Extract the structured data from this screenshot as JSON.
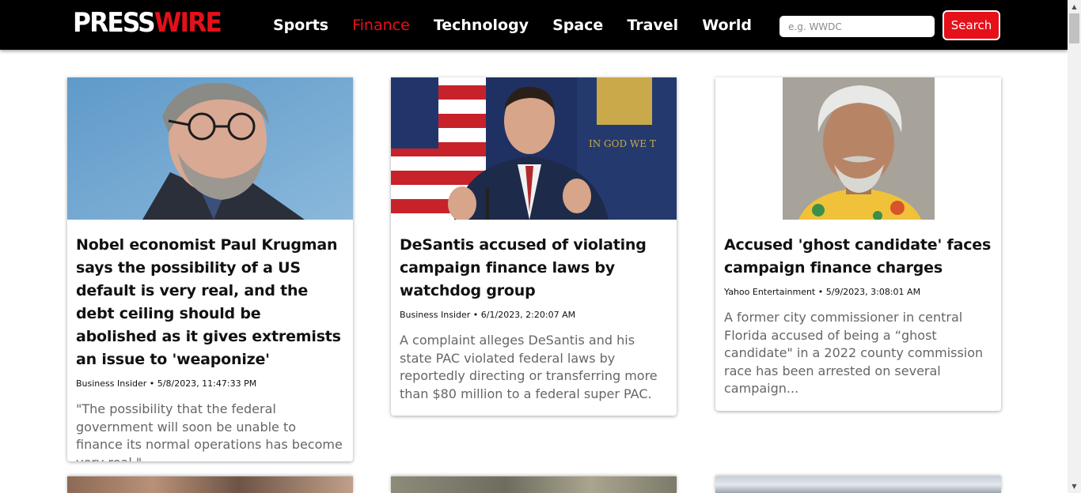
{
  "header": {
    "logo": {
      "part1": "PRESS",
      "part2": "WIRE"
    },
    "nav": [
      {
        "label": "Sports",
        "active": false
      },
      {
        "label": "Finance",
        "active": true
      },
      {
        "label": "Technology",
        "active": false
      },
      {
        "label": "Space",
        "active": false
      },
      {
        "label": "Travel",
        "active": false
      },
      {
        "label": "World",
        "active": false
      }
    ],
    "search": {
      "placeholder": "e.g. WWDC",
      "value": "",
      "button_label": "Search"
    }
  },
  "articles": [
    {
      "title": "Nobel economist Paul Krugman says the possibility of a US default is very real, and the debt ceiling should be abolished as it gives extremists an issue to 'weaponize'",
      "source": "Business Insider",
      "date": "5/8/2023, 11:47:33 PM",
      "description": "\"The possibility that the federal government will soon be unable to finance its normal operations has become very real.\"",
      "image": "portrait-man-glasses-blue-background"
    },
    {
      "title": "DeSantis accused of violating campaign finance laws by watchdog group",
      "source": "Business Insider",
      "date": "6/1/2023, 2:20:07 AM",
      "description": "A complaint alleges DeSantis and his state PAC violated federal laws by reportedly directing or transferring more than $80 million to a federal super PAC.",
      "image": "man-speaking-at-podium-flags",
      "image_text": "IN GOD WE T"
    },
    {
      "title": "Accused 'ghost candidate' faces campaign finance charges",
      "source": "Yahoo Entertainment",
      "date": "5/9/2023, 3:08:01 AM",
      "description": "A former city commissioner in central Florida accused of being a “ghost candidate\" in a 2022 county commission race has been arrested on several campaign...",
      "image": "mugshot-white-haired-man"
    }
  ],
  "colors": {
    "accent": "#e5101a",
    "nav_bg": "#000000",
    "description_text": "#666666"
  },
  "meta_separator": "•"
}
